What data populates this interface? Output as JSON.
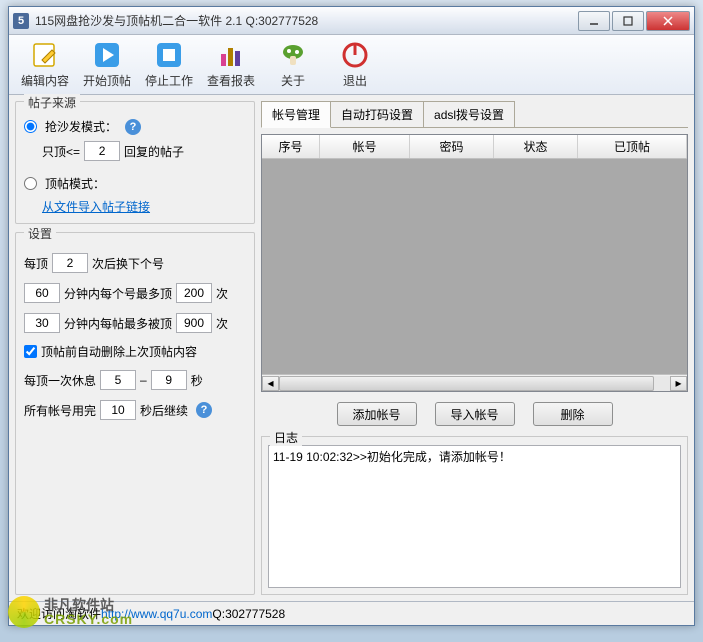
{
  "window": {
    "title": "115网盘抢沙发与顶帖机二合一软件 2.1 Q:302777528",
    "icon_label": "5"
  },
  "toolbar": {
    "edit": "编辑内容",
    "start": "开始顶帖",
    "stop": "停止工作",
    "report": "查看报表",
    "about": "关于",
    "exit": "退出"
  },
  "source": {
    "group_title": "帖子来源",
    "mode_sofa": "抢沙发模式：",
    "only_reply_prefix": "只顶<=",
    "only_reply_value": "2",
    "only_reply_suffix": "回复的帖子",
    "mode_bump": "顶帖模式：",
    "import_link": "从文件导入帖子链接"
  },
  "settings": {
    "group_title": "设置",
    "row1_prefix": "每顶",
    "row1_value": "2",
    "row1_suffix": "次后换下个号",
    "row2_v1": "60",
    "row2_mid": "分钟内每个号最多顶",
    "row2_v2": "200",
    "row2_suffix": "次",
    "row3_v1": "30",
    "row3_mid": "分钟内每帖最多被顶",
    "row3_v2": "900",
    "row3_suffix": "次",
    "chk_label": "顶帖前自动删除上次顶帖内容",
    "rest_prefix": "每顶一次休息",
    "rest_v1": "5",
    "rest_dash": "–",
    "rest_v2": "9",
    "rest_suffix": "秒",
    "cont_prefix": "所有帐号用完",
    "cont_value": "10",
    "cont_suffix": "秒后继续"
  },
  "tabs": {
    "t1": "帐号管理",
    "t2": "自动打码设置",
    "t3": "adsl拨号设置"
  },
  "table_headers": [
    "序号",
    "帐号",
    "密码",
    "状态",
    "已顶帖"
  ],
  "buttons": {
    "add": "添加帐号",
    "import": "导入帐号",
    "delete": "删除"
  },
  "log": {
    "title": "日志",
    "content": "11-19 10:02:32>>初始化完成，请添加帐号！"
  },
  "statusbar": {
    "prefix": "欢迎访问淘软件 ",
    "url": "http://www.qq7u.com",
    "suffix": " Q:302777528"
  },
  "watermark": {
    "line1": "非凡软件站",
    "line2": "CRSKY.com"
  }
}
